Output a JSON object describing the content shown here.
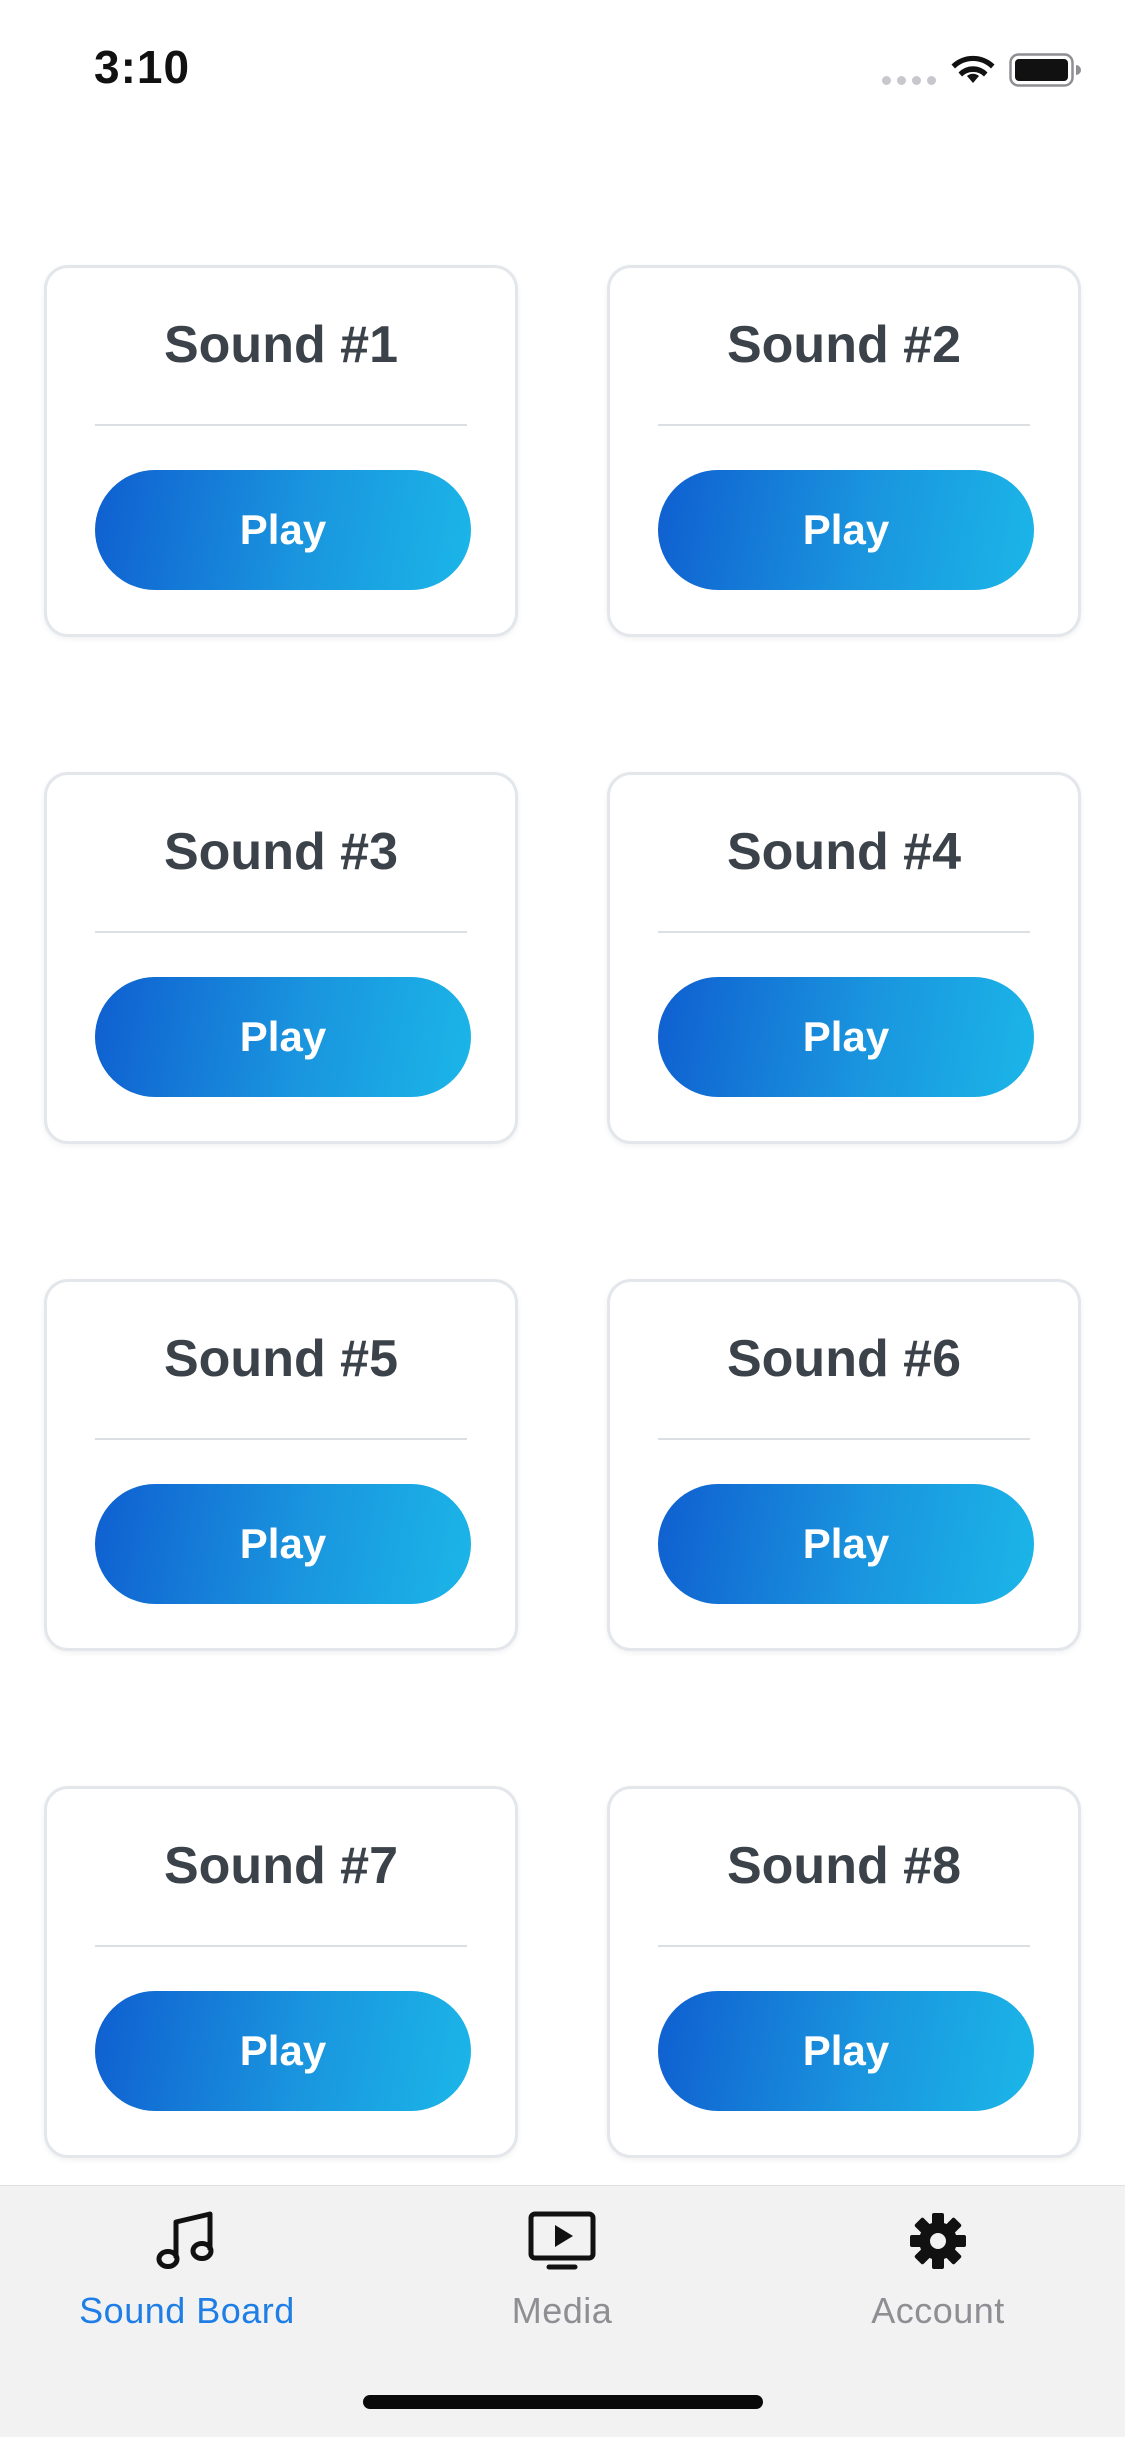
{
  "status_bar": {
    "time": "3:10",
    "icons": [
      "cellular-signal-icon",
      "wifi-icon",
      "battery-icon"
    ]
  },
  "sounds": [
    {
      "title": "Sound #1",
      "button_label": "Play"
    },
    {
      "title": "Sound #2",
      "button_label": "Play"
    },
    {
      "title": "Sound #3",
      "button_label": "Play"
    },
    {
      "title": "Sound #4",
      "button_label": "Play"
    },
    {
      "title": "Sound #5",
      "button_label": "Play"
    },
    {
      "title": "Sound #6",
      "button_label": "Play"
    },
    {
      "title": "Sound #7",
      "button_label": "Play"
    },
    {
      "title": "Sound #8",
      "button_label": "Play"
    }
  ],
  "tab_bar": {
    "tabs": [
      {
        "label": "Sound Board",
        "icon": "music-note-icon",
        "active": true
      },
      {
        "label": "Media",
        "icon": "tv-play-icon",
        "active": false
      },
      {
        "label": "Account",
        "icon": "gear-icon",
        "active": false
      }
    ]
  },
  "colors": {
    "accent": "#1e7ee6",
    "button_gradient_start": "#0f5fd0",
    "button_gradient_end": "#1bb6e8",
    "card_title": "#3b4249",
    "tab_inactive": "#8e8e93",
    "tab_bar_background": "#f2f2f2"
  }
}
